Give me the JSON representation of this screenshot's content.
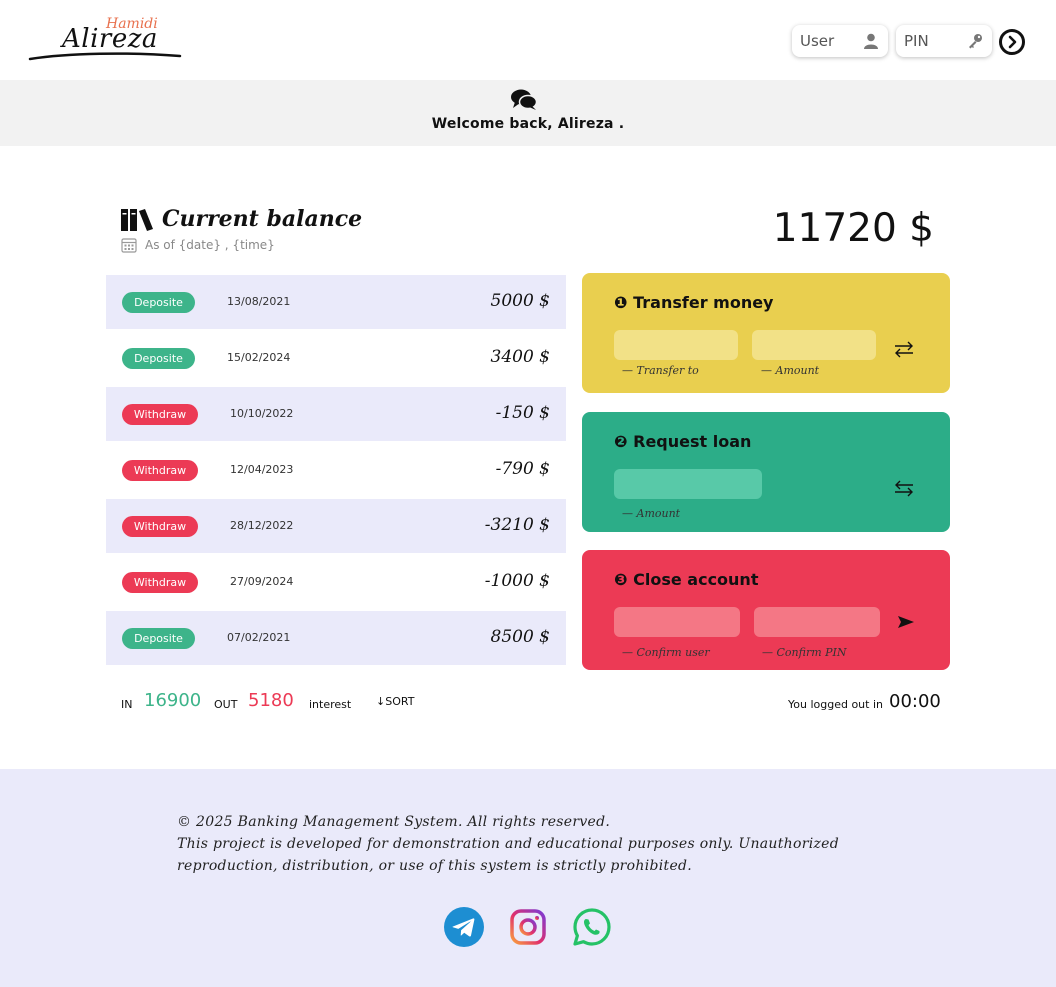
{
  "header": {
    "logo_small": "Hamidi",
    "logo_big": "Alireza",
    "user_placeholder": "User",
    "pin_placeholder": "PIN",
    "icons": {
      "user": "user-icon",
      "pin": "key-icon",
      "login": "arrow-right-circle-icon"
    }
  },
  "banner": {
    "welcome": "Welcome back, Alireza .",
    "icon": "chat-bubbles-icon"
  },
  "balance": {
    "title": "Current balance",
    "as_of": "As of {date} , {time}",
    "amount": "11720 $",
    "icons": {
      "title": "books-icon",
      "date": "calendar-icon"
    }
  },
  "movements": [
    {
      "type": "Deposite",
      "kind": "deposit",
      "date": "13/08/2021",
      "amount": "5000 $"
    },
    {
      "type": "Deposite",
      "kind": "deposit",
      "date": "15/02/2024",
      "amount": "3400 $"
    },
    {
      "type": "Withdraw",
      "kind": "withdraw",
      "date": "10/10/2022",
      "amount": "-150 $"
    },
    {
      "type": "Withdraw",
      "kind": "withdraw",
      "date": "12/04/2023",
      "amount": "-790 $"
    },
    {
      "type": "Withdraw",
      "kind": "withdraw",
      "date": "28/12/2022",
      "amount": "-3210 $"
    },
    {
      "type": "Withdraw",
      "kind": "withdraw",
      "date": "27/09/2024",
      "amount": "-1000 $"
    },
    {
      "type": "Deposite",
      "kind": "deposit",
      "date": "07/02/2021",
      "amount": "8500 $"
    }
  ],
  "operations": {
    "transfer": {
      "title": "❶ Transfer money",
      "label_to": "— Transfer to",
      "label_amount": "— Amount",
      "button_icon": "swap-arrows-icon"
    },
    "loan": {
      "title": "❷ Request loan",
      "label_amount": "— Amount",
      "button_icon": "swap-arrows-reverse-icon"
    },
    "close": {
      "title": "❸ Close account",
      "label_user": "— Confirm user",
      "label_pin": "— Confirm PIN",
      "button_icon": "send-arrow-icon"
    }
  },
  "summary": {
    "in_label": "IN",
    "in_value": "16900",
    "out_label": "OUT",
    "out_value": "5180",
    "interest_label": "interest",
    "sort_label": "↓SORT",
    "logout_text": "You logged out in",
    "timer": "00:00"
  },
  "footer": {
    "line1": "© 2025 Banking Management System. All rights reserved.",
    "line2": "This project is developed for demonstration and educational purposes only. Unauthorized reproduction, distribution, or use of this system is strictly prohibited.",
    "socials": [
      "telegram-icon",
      "instagram-icon",
      "whatsapp-icon"
    ]
  },
  "colors": {
    "deposit": "#3db48a",
    "withdraw": "#ec3a55",
    "transfer_card": "#e9cf4f",
    "loan_card": "#2cad88",
    "close_card": "#ec3a55",
    "row_shade": "#eaeafa"
  }
}
